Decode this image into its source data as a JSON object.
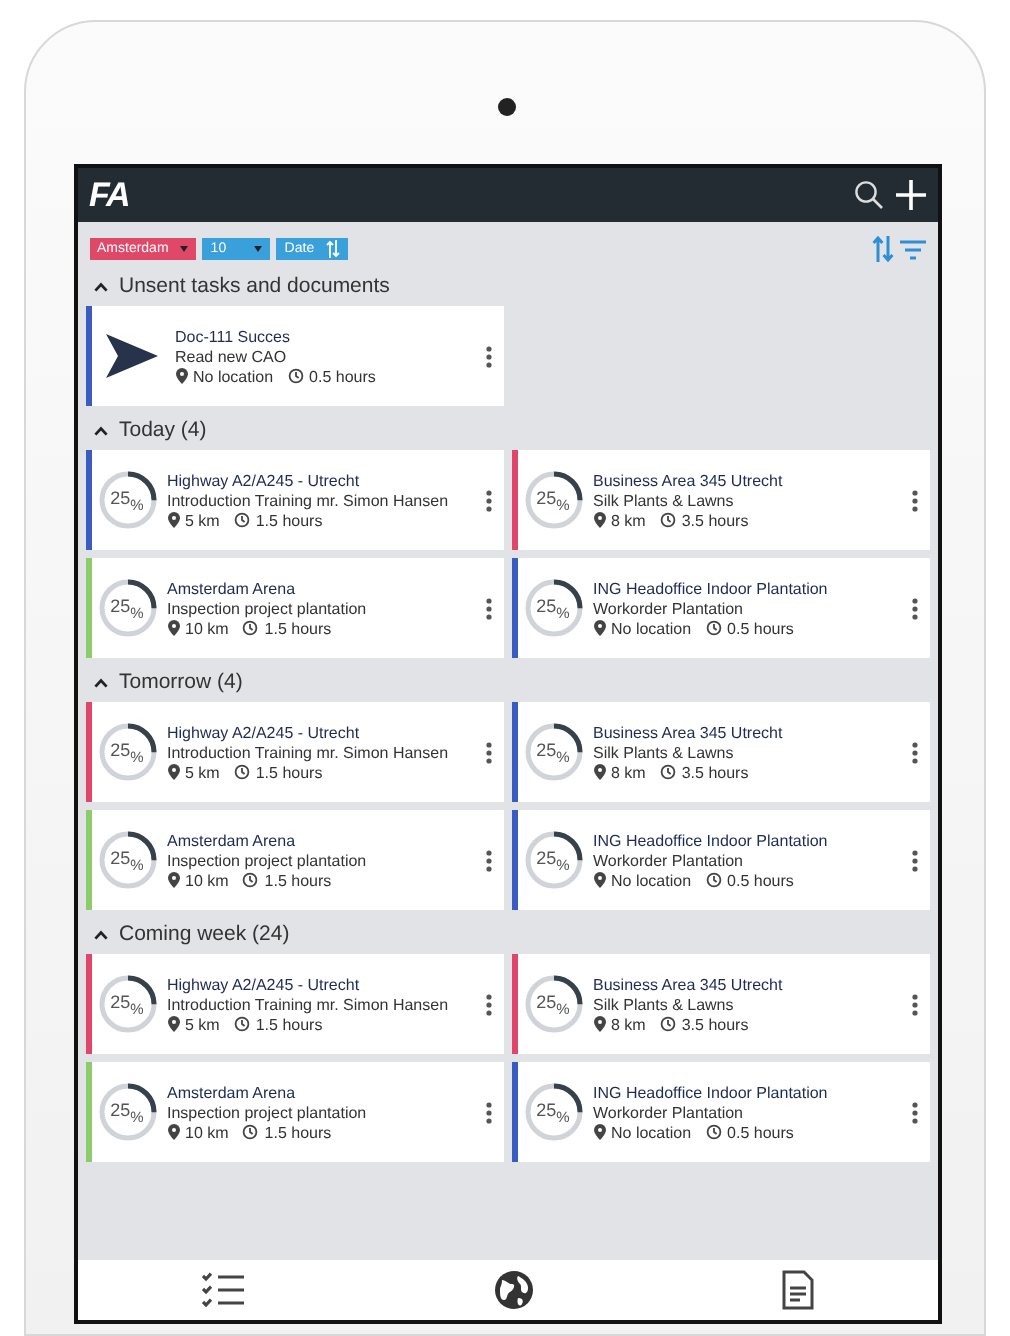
{
  "app": {
    "logo": "FA"
  },
  "filters": [
    {
      "label": "Amsterdam",
      "kind": "dropdown",
      "color": "#e04868"
    },
    {
      "label": "10",
      "kind": "dropdown",
      "color": "#3aa0dc"
    },
    {
      "label": "Date",
      "kind": "sort",
      "color": "#3aa0dc"
    }
  ],
  "sections": [
    {
      "title": "Unsent tasks and documents",
      "expanded": true,
      "cards": [
        {
          "kind": "document",
          "color": "#3a5bbf",
          "title": "Doc-111 Succes",
          "subtitle": "Read new CAO",
          "distance": "No location",
          "duration": "0.5 hours"
        }
      ]
    },
    {
      "title": "Today (4)",
      "expanded": true,
      "cards": [
        {
          "kind": "task",
          "color": "#3a5bbf",
          "progress": "25$_{%}$",
          "title": "Highway A2/A245 - Utrecht",
          "subtitle": "Introduction Training mr. Simon Hansen",
          "distance": "5 km",
          "duration": "1.5 hours"
        },
        {
          "kind": "task",
          "color": "#e0456a",
          "progress": "25$_{%}$",
          "title": "Business Area 345 Utrecht",
          "subtitle": "Silk Plants & Lawns",
          "distance": "8 km",
          "duration": "3.5 hours"
        },
        {
          "kind": "task",
          "color": "#8ccc6a",
          "progress": "25$_{%}$",
          "title": "Amsterdam Arena",
          "subtitle": "Inspection project plantation",
          "distance": "10 km",
          "duration": "1.5 hours"
        },
        {
          "kind": "task",
          "color": "#3a5bbf",
          "progress": "25$_{%}$",
          "title": "ING Headoffice Indoor Plantation",
          "subtitle": "Workorder Plantation",
          "distance": "No location",
          "duration": "0.5 hours"
        }
      ]
    },
    {
      "title": "Tomorrow (4)",
      "expanded": true,
      "cards": [
        {
          "kind": "task",
          "color": "#e0456a",
          "progress": "25$_{%}$",
          "title": "Highway A2/A245 - Utrecht",
          "subtitle": "Introduction Training mr. Simon Hansen",
          "distance": "5 km",
          "duration": "1.5 hours"
        },
        {
          "kind": "task",
          "color": "#3a5bbf",
          "progress": "25$_{%}$",
          "title": "Business Area 345 Utrecht",
          "subtitle": "Silk Plants & Lawns",
          "distance": "8 km",
          "duration": "3.5 hours"
        },
        {
          "kind": "task",
          "color": "#8ccc6a",
          "progress": "25$_{%}$",
          "title": "Amsterdam Arena",
          "subtitle": "Inspection project plantation",
          "distance": "10 km",
          "duration": "1.5 hours"
        },
        {
          "kind": "task",
          "color": "#3a5bbf",
          "progress": "25$_{%}$",
          "title": "ING Headoffice Indoor Plantation",
          "subtitle": "Workorder Plantation",
          "distance": "No location",
          "duration": "0.5 hours"
        }
      ]
    },
    {
      "title": "Coming week (24)",
      "expanded": true,
      "cards": [
        {
          "kind": "task",
          "color": "#e0456a",
          "progress": "25$_{%}$",
          "title": "Highway A2/A245 - Utrecht",
          "subtitle": "Introduction Training mr. Simon Hansen",
          "distance": "5 km",
          "duration": "1.5 hours"
        },
        {
          "kind": "task",
          "color": "#e0456a",
          "progress": "25$_{%}$",
          "title": "Business Area 345 Utrecht",
          "subtitle": "Silk Plants & Lawns",
          "distance": "8 km",
          "duration": "3.5 hours"
        },
        {
          "kind": "task",
          "color": "#8ccc6a",
          "progress": "25$_{%}$",
          "title": "Amsterdam Arena",
          "subtitle": "Inspection project plantation",
          "distance": "10 km",
          "duration": "1.5 hours"
        },
        {
          "kind": "task",
          "color": "#3a5bbf",
          "progress": "25$_{%}$",
          "title": "ING Headoffice Indoor Plantation",
          "subtitle": "Workorder Plantation",
          "distance": "No location",
          "duration": "0.5 hours"
        }
      ]
    }
  ]
}
